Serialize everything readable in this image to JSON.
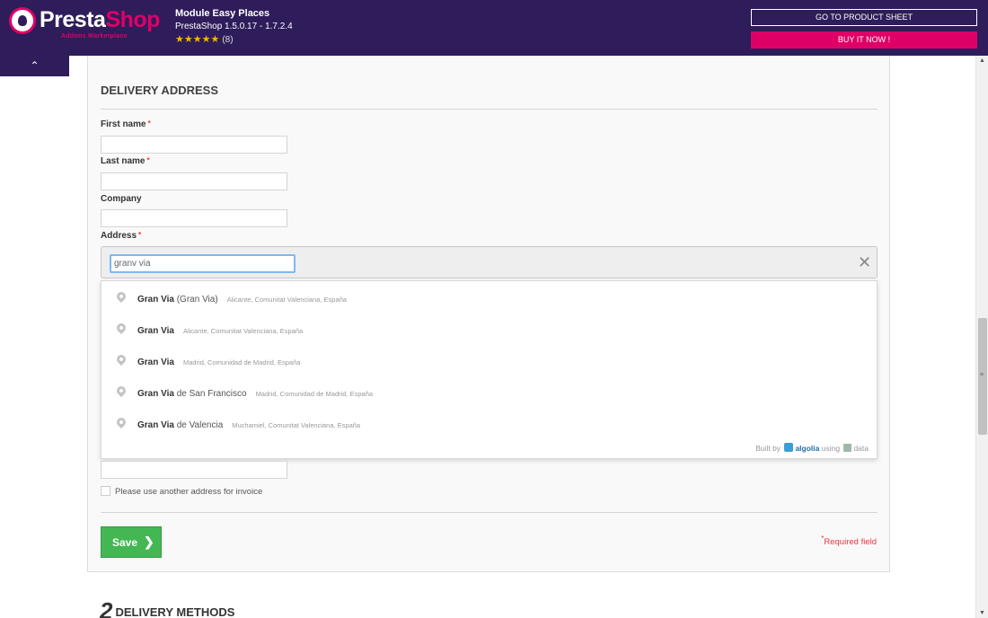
{
  "topbar": {
    "logo_text_main": "Presta",
    "logo_text_accent": "Shop",
    "logo_sub": "Addons Marketplace",
    "module_title": "Module Easy Places",
    "module_version": "PrestaShop 1.5.0.17 - 1.7.2.4",
    "rating_stars": "★★★★★",
    "rating_count": "(8)",
    "product_sheet_label": "GO TO PRODUCT SHEET",
    "buy_label": "BUY IT NOW !",
    "collapse_icon": "chevron-up-icon",
    "collapse_glyph": "⌃"
  },
  "form": {
    "section_title": "DELIVERY ADDRESS",
    "first_name_label": "First name",
    "last_name_label": "Last name",
    "company_label": "Company",
    "address_label": "Address",
    "required_mark": "*",
    "address_value": "granv via",
    "clear_glyph": "✕",
    "suggestions": [
      {
        "main": "Gran Via",
        "extra": " (Gran Via)",
        "sub": "Alicante, Comunitat Valenciana, España"
      },
      {
        "main": "Gran Via",
        "extra": "",
        "sub": "Alicante, Comunitat Valenciana, España"
      },
      {
        "main": "Gran Via",
        "extra": "",
        "sub": "Madrid, Comunidad de Madrid, España"
      },
      {
        "main": "Gran Via",
        "extra": " de San Francisco",
        "sub": "Madrid, Comunidad de Madrid, España"
      },
      {
        "main": "Gran Via",
        "extra": " de Valencia",
        "sub": "Muchamiel, Comunitat Valenciana, España"
      }
    ],
    "algolia": {
      "built_by": "Built by",
      "name": "algolia",
      "using": "using",
      "data": "data"
    },
    "invoice_checkbox_label": "Please use another address for invoice",
    "save_label": "Save",
    "save_chevron": "❯",
    "required_field_mark": "*",
    "required_field_text": "Required field"
  },
  "next_section": {
    "number": "2",
    "title": "DELIVERY METHODS"
  },
  "scrollbar": {
    "up": "▲",
    "down": "▼",
    "grip": "≡"
  },
  "colors": {
    "header_bg": "#2f1c5b",
    "accent_pink": "#df0067",
    "save_green": "#43b754",
    "required_red": "#f13340"
  }
}
